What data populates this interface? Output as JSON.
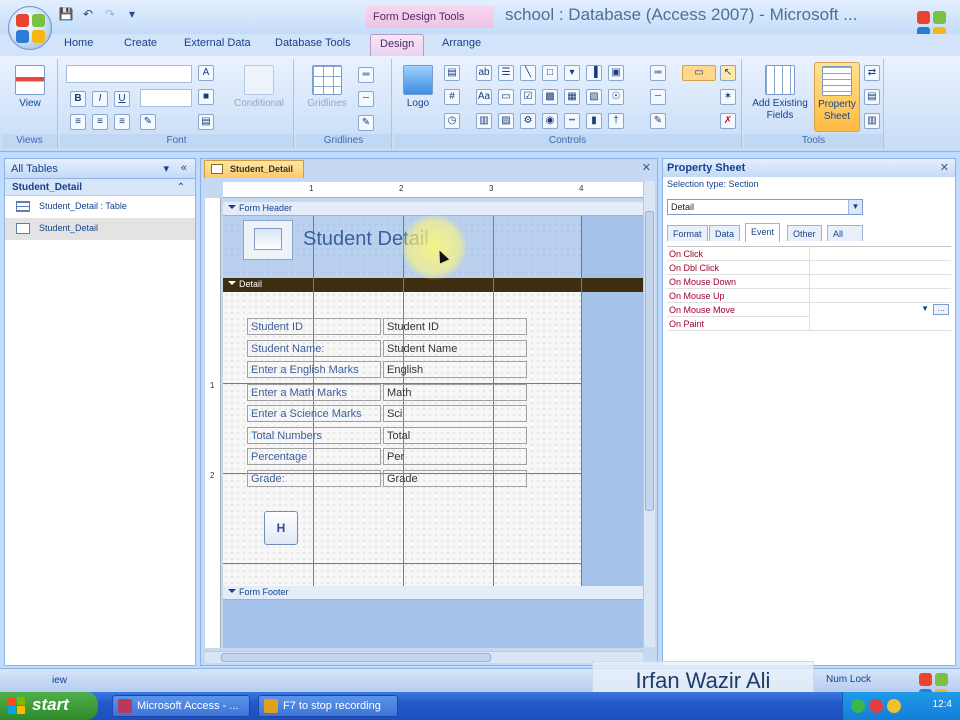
{
  "titlebar": {
    "context_tab": "Form Design Tools",
    "title": "school : Database (Access 2007) - Microsoft ..."
  },
  "tabs": [
    "Home",
    "Create",
    "External Data",
    "Database Tools",
    "Design",
    "Arrange"
  ],
  "active_tab": "Design",
  "ribbon": {
    "groups": {
      "views": "Views",
      "font": "Font",
      "gridlines": "Gridlines",
      "controls": "Controls",
      "tools": "Tools"
    },
    "view_button": "View",
    "conditional_button": "Conditional",
    "gridlines_button": "Gridlines",
    "logo_button": "Logo",
    "add_existing_fields": "Add Existing Fields",
    "property_sheet": "Property Sheet"
  },
  "navpane": {
    "header": "All Tables",
    "section": "Student_Detail",
    "items": [
      {
        "label": "Student_Detail : Table"
      },
      {
        "label": "Student_Detail"
      }
    ]
  },
  "document": {
    "tab_label": "Student_Detail",
    "ruler_numbers": [
      "1",
      "2",
      "3",
      "4",
      "1",
      "2"
    ],
    "form_header_label": "Form Header",
    "detail_label": "Detail",
    "form_footer_label": "Form Footer",
    "form_title": "Student Detail",
    "nav_button": "H",
    "fields": [
      {
        "label": "Student ID",
        "control": "Student  ID"
      },
      {
        "label": "Student Name:",
        "control": "Student  Name"
      },
      {
        "label": "Enter a English Marks",
        "control": "English"
      },
      {
        "label": "Enter a Math Marks",
        "control": "Math"
      },
      {
        "label": "Enter a Science Marks",
        "control": "Sci"
      },
      {
        "label": "Total Numbers",
        "control": "Total"
      },
      {
        "label": "Percentage",
        "control": "Per"
      },
      {
        "label": "Grade:",
        "control": "Grade"
      }
    ]
  },
  "property_sheet": {
    "title": "Property Sheet",
    "selection_type": "Selection type:  Section",
    "selected": "Detail",
    "tabs": [
      "Format",
      "Data",
      "Event",
      "Other",
      "All"
    ],
    "active_tab": "Event",
    "rows": [
      "On Click",
      "On Dbl Click",
      "On Mouse Down",
      "On Mouse Up",
      "On Mouse Move",
      "On Paint"
    ]
  },
  "statusbar": {
    "left": "iew",
    "num_lock": "Num Lock"
  },
  "watermark": "Irfan Wazir Ali",
  "taskbar": {
    "start": "start",
    "buttons": [
      "Microsoft Access - ...",
      "F7 to stop recording"
    ],
    "clock": "12:4"
  },
  "colors": {
    "accent": "#15428b",
    "ribbon_bg": "#c7dcf6",
    "detail_bar": "#3f2e12",
    "context_tab": "#f7d7ee",
    "property_event_text": "#a0002a"
  }
}
